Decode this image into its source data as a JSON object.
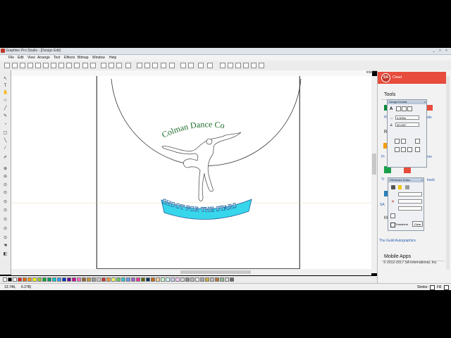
{
  "window": {
    "title": "Graphtec Pro Studio - [Design Edit]",
    "controls": [
      "_",
      "□",
      "×"
    ]
  },
  "menu": [
    "File",
    "Edit",
    "View",
    "Arrange",
    "Text",
    "Effects",
    "Bitmap",
    "Window",
    "Help"
  ],
  "ruler": {
    "unit": "in/ed"
  },
  "design": {
    "arc_text_top": "Colman Dance Co",
    "arc_text_bottom": "SHOOT FOR THE STARS"
  },
  "status": {
    "coords_x": "13.746,",
    "coords_y": "6.278)",
    "stroke_label": "Stroke:",
    "fill_label": "Fill"
  },
  "right_panel": {
    "header_label": "Cloud",
    "tools_heading": "Tools",
    "ptext": "Pl",
    "rtext": "R",
    "stext": "SA",
    "guild_link": "The Guild Autographics",
    "mobile_heading": "Mobile Apps",
    "copyright": "© 2012-2017 SA International, Inc.",
    "frag_ats": "ats",
    "frag_me": "me",
    "frag_book": "book",
    "frag_pr": "Pr",
    "frag_tr": "Tr",
    "frag_m": "M"
  },
  "design_central": {
    "title": "DesignCentral",
    "size_value": "4.000in",
    "angle_value": "30.000°"
  },
  "fill_stroke": {
    "title": "Fill/Stroke Editor",
    "transform_label": "Transform",
    "clear_label": "Clear"
  },
  "colors": {
    "accent_red": "#e74c3c",
    "top_text": "#1d6b2a",
    "bottom_text_fill": "#37d6ea",
    "bottom_text_stroke": "#1f5fa0"
  }
}
